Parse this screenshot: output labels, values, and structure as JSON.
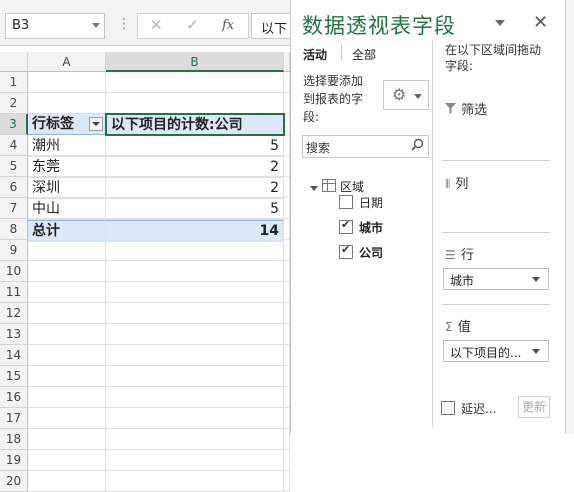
{
  "formula_bar": {
    "cell_ref": "B3",
    "formula_preview": "以下",
    "cancel_glyph": "✕",
    "enter_glyph": "✓",
    "fx_label": "fx"
  },
  "sheet": {
    "columns": [
      "A",
      "B"
    ],
    "rows": [
      "1",
      "2",
      "3",
      "4",
      "5",
      "6",
      "7",
      "8",
      "9",
      "10",
      "11",
      "12",
      "13",
      "14",
      "15",
      "16",
      "17",
      "18",
      "19",
      "20"
    ],
    "pivot": {
      "row_label_header": "行标签",
      "value_header": "以下项目的计数:公司",
      "rows": [
        {
          "label": "潮州",
          "value": "5"
        },
        {
          "label": "东莞",
          "value": "2"
        },
        {
          "label": "深圳",
          "value": "2"
        },
        {
          "label": "中山",
          "value": "5"
        }
      ],
      "total_label": "总计",
      "total_value": "14"
    }
  },
  "pivot_pane": {
    "title": "数据透视表字段",
    "tabs": [
      "活动",
      "全部"
    ],
    "instruction_line1": "选择要添加",
    "instruction_line2": "到报表的字",
    "instruction_line3": "段:",
    "search_placeholder": "搜索",
    "table_name": "区域",
    "fields": [
      {
        "name": "日期",
        "checked": false
      },
      {
        "name": "城市",
        "checked": true
      },
      {
        "name": "公司",
        "checked": true
      }
    ],
    "drag_hint_line1": "在以下区域间拖动",
    "drag_hint_line2": "字段:",
    "zones": {
      "filters": {
        "label": "筛选",
        "icon": "filter-icon"
      },
      "columns": {
        "label": "列",
        "icon": "columns-icon"
      },
      "rows": {
        "label": "行",
        "icon": "rows-icon",
        "item": "城市"
      },
      "values": {
        "label": "值",
        "icon": "sigma-icon",
        "item": "以下项目的..."
      }
    },
    "defer_label": "延迟...",
    "update_label": "更新",
    "accent_color": "#217346"
  }
}
